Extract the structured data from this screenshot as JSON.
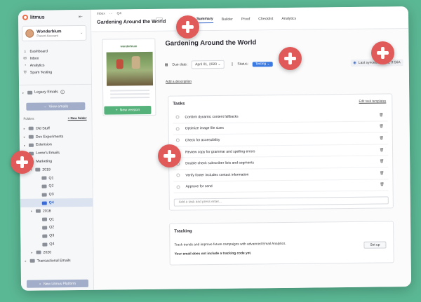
{
  "app": {
    "name": "litmus"
  },
  "account": {
    "name": "Wonderbium",
    "subtitle": "Parent Account"
  },
  "nav": [
    {
      "label": "Dashboard",
      "icon": "home-icon",
      "glyph": "⌂"
    },
    {
      "label": "Inbox",
      "icon": "inbox-icon",
      "glyph": "✉"
    },
    {
      "label": "Analytics",
      "icon": "analytics-icon",
      "glyph": "◔"
    },
    {
      "label": "Spam Testing",
      "icon": "shield-icon",
      "glyph": "⛨"
    }
  ],
  "legacy": {
    "label": "Legacy Emails",
    "help": "?"
  },
  "view_emails": "View emails",
  "folders": {
    "header": "Folders",
    "new_folder": "New folder"
  },
  "tree": [
    {
      "label": "Old Stuff",
      "depth": 0
    },
    {
      "label": "Dev Experiments",
      "depth": 0
    },
    {
      "label": "Extension",
      "depth": 0
    },
    {
      "label": "Lorne's Emails",
      "depth": 0
    },
    {
      "label": "Marketing",
      "depth": 0
    },
    {
      "label": "2019",
      "depth": 1
    },
    {
      "label": "Q1",
      "depth": 2
    },
    {
      "label": "Q2",
      "depth": 2
    },
    {
      "label": "Q3",
      "depth": 2
    },
    {
      "label": "Q4",
      "depth": 2,
      "selected": true
    },
    {
      "label": "2018",
      "depth": 1
    },
    {
      "label": "Q1",
      "depth": 2
    },
    {
      "label": "Q2",
      "depth": 2
    },
    {
      "label": "Q3",
      "depth": 2
    },
    {
      "label": "Q4",
      "depth": 2
    },
    {
      "label": "2020",
      "depth": 1
    },
    {
      "label": "Transactional Emails",
      "depth": 0
    }
  ],
  "new_platform": "New Litmus Platform",
  "breadcrumbs": [
    "Inbox",
    "···",
    "Q4"
  ],
  "page_title": "Gardening Around the World",
  "more": "···",
  "tabs": [
    "Summary",
    "Builder",
    "Proof",
    "Checklist",
    "Analytics"
  ],
  "active_tab": "Summary",
  "thumbnail": {
    "brand": "wonderbium"
  },
  "new_version": "New version",
  "email_title": "Gardening Around the World",
  "meta": {
    "due_label": "Due date:",
    "due_value": "April 01, 2020",
    "status_label": "Status:",
    "status_value": "Testing",
    "synced": "Last synced: Jun 11, 9:56A"
  },
  "add_description": "Add a description",
  "tasks": {
    "title": "Tasks",
    "edit_templates": "Edit task templates",
    "items": [
      "Confirm dynamic content fallbacks",
      "Optimize image file sizes",
      "Check for accessibility",
      "Review copy for grammar and spelling errors",
      "Double-check subscriber lists and segments",
      "Verify footer includes contact information",
      "Approve for send"
    ],
    "placeholder": "Add a task and press enter..."
  },
  "tracking": {
    "title": "Tracking",
    "description": "Track trends and improve future campaigns with advanced Email Analytics.",
    "warning": "Your email does not include a tracking code yet.",
    "setup": "Set up"
  },
  "colors": {
    "accent": "#2f62c8",
    "brand": "#ee6e46",
    "success": "#55b27a",
    "marker": "#e05a59",
    "background": "#5bb895"
  }
}
